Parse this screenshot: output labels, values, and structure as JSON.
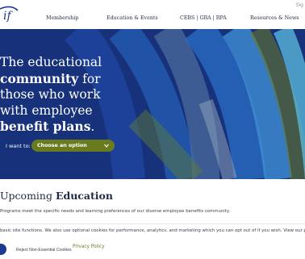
{
  "header": {
    "signin": "Sig",
    "nav": [
      {
        "label": "Membership"
      },
      {
        "label": "Education & Events"
      },
      {
        "label": "CEBS | GBA | RPA"
      },
      {
        "label": "Resources & News"
      }
    ]
  },
  "hero": {
    "line1": "The educational",
    "line2_bold": "community",
    "line2_rest": " for",
    "line3": "those who work",
    "line4": "with employee",
    "line5_bold": "benefit plans",
    "line5_rest": ".",
    "want_label": "I want to:",
    "select_value": "Choose an option",
    "colors": {
      "background": "#17317a",
      "select": "#6a7a1e"
    }
  },
  "upcoming": {
    "title_plain": "Upcoming ",
    "title_bold": "Education",
    "description": "Programs meet the specific needs and learning preferences of our diverse employee benefits community."
  },
  "cookie": {
    "text": "basic site functions. We also use optional cookies for performance, analytics, and marketing which you can opt out of if you wish. View our privacy poli",
    "reject_label": "Reject Non-Essential Cookies",
    "privacy_label": "Privacy Policy"
  }
}
